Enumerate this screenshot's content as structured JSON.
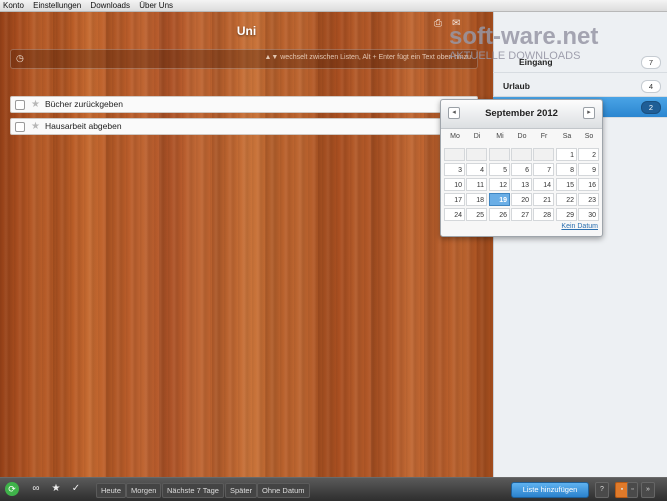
{
  "menubar": {
    "items": [
      "Konto",
      "Einstellungen",
      "Downloads",
      "Über Uns"
    ]
  },
  "list": {
    "title": "Uni",
    "add_hint": "▲▼ wechselt zwischen Listen, Alt + Enter fügt ein Text oben hinzu",
    "tasks": [
      {
        "text": "Bücher zurückgeben"
      },
      {
        "text": "Hausarbeit abgeben"
      }
    ]
  },
  "watermark": {
    "logo": "soft-ware.net",
    "tagline": "AKTUELLE DOWNLOADS"
  },
  "sidebar": {
    "items": [
      {
        "label": "Eingang",
        "count": "7"
      },
      {
        "label": "Urlaub",
        "count": "4"
      },
      {
        "label": "",
        "count": "2",
        "active": true
      }
    ]
  },
  "calendar": {
    "title": "September 2012",
    "weekdays": [
      "Mo",
      "Di",
      "Mi",
      "Do",
      "Fr",
      "Sa",
      "So"
    ],
    "weeks": [
      [
        "",
        "",
        "",
        "",
        "",
        "1",
        "2"
      ],
      [
        "3",
        "4",
        "5",
        "6",
        "7",
        "8",
        "9"
      ],
      [
        "10",
        "11",
        "12",
        "13",
        "14",
        "15",
        "16"
      ],
      [
        "17",
        "18",
        "19",
        "20",
        "21",
        "22",
        "23"
      ],
      [
        "24",
        "25",
        "26",
        "27",
        "28",
        "29",
        "30"
      ]
    ],
    "today": "19",
    "no_date": "Kein Datum"
  },
  "bottombar": {
    "filters": [
      "Heute",
      "Morgen",
      "Nächste 7 Tage",
      "Später",
      "Ohne Datum"
    ],
    "add_list": "Liste hinzufügen",
    "help": "?"
  },
  "colors": {
    "accent": "#2b86d0",
    "sync": "#3fb34a"
  }
}
